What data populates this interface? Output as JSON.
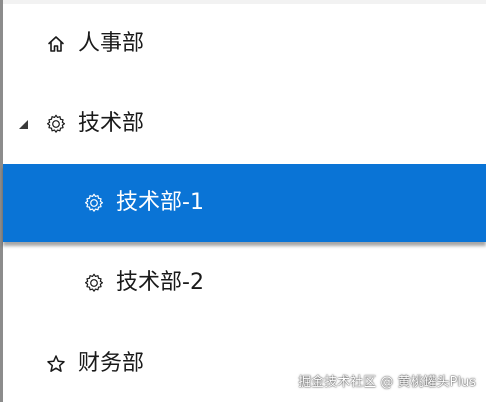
{
  "tree": {
    "items": [
      {
        "label": "人事部",
        "icon": "home-icon"
      },
      {
        "label": "技术部",
        "icon": "gear-icon",
        "expanded": true
      },
      {
        "label": "技术部-1",
        "icon": "gear-icon",
        "selected": true
      },
      {
        "label": "技术部-2",
        "icon": "gear-icon"
      },
      {
        "label": "财务部",
        "icon": "star-icon"
      }
    ]
  },
  "colors": {
    "selection": "#0a74d6",
    "text": "#1a1a1a",
    "selected_text": "#ffffff"
  },
  "watermark": "掘金技术社区 @ 黄桃罐头Plus"
}
